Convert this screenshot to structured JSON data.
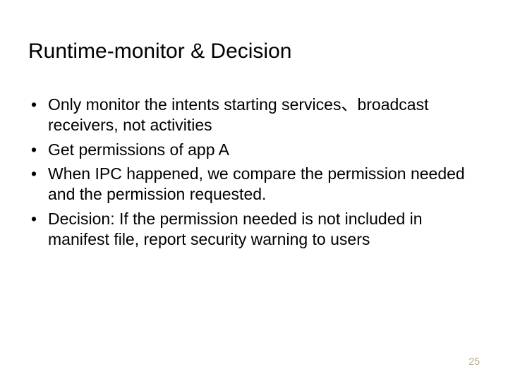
{
  "title": "Runtime-monitor & Decision",
  "bullets": [
    "Only monitor the intents starting services、broadcast receivers, not activities",
    "Get permissions of app A",
    "When IPC  happened,  we compare the permission needed and the permission requested.",
    "Decision: If the permission needed is not included in manifest file, report security warning to users"
  ],
  "pageNumber": "25"
}
